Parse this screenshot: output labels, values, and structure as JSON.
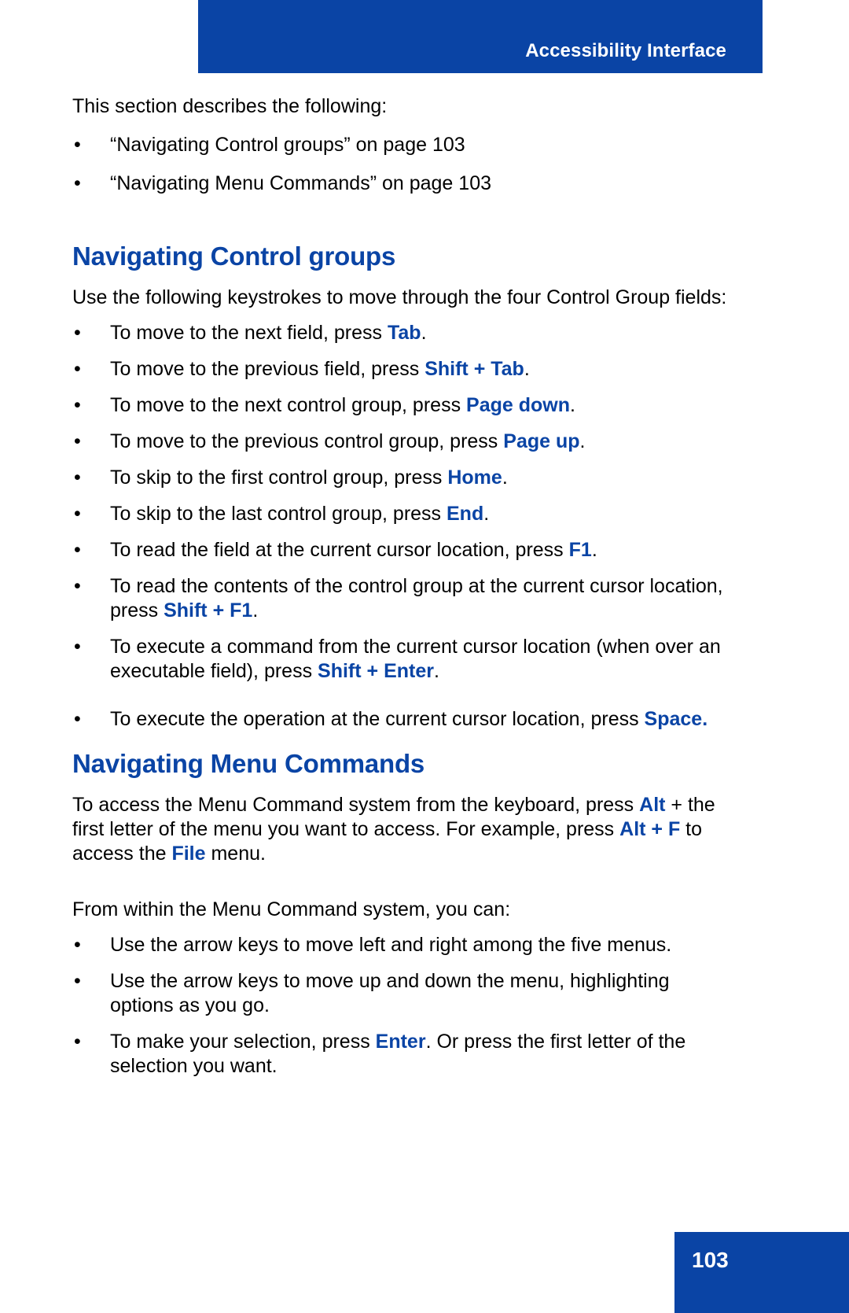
{
  "header": {
    "title": "Accessibility Interface",
    "accent_color": "#0A44A5"
  },
  "intro": {
    "lead": "This section describes the following:",
    "toc": [
      "“Navigating Control groups” on page 103",
      "“Navigating Menu Commands” on page 103"
    ]
  },
  "bullet_glyph": "•",
  "sections": [
    {
      "heading": "Navigating Control groups",
      "intro": "Use the following keystrokes to move through the four Control Group fields:",
      "items": [
        {
          "pre": "To move to the next field, press ",
          "key": "Tab",
          "post": "."
        },
        {
          "pre": "To move to the previous field, press ",
          "key": "Shift + Tab",
          "post": "."
        },
        {
          "pre": "To move to the next control group, press ",
          "key": "Page down",
          "post": "."
        },
        {
          "pre": "To move to the previous control group, press ",
          "key": "Page up",
          "post": "."
        },
        {
          "pre": "To skip to the first control group, press ",
          "key": "Home",
          "post": "."
        },
        {
          "pre": "To skip to the last control group, press ",
          "key": "End",
          "post": "."
        },
        {
          "pre": "To read the field at the current cursor location, press ",
          "key": "F1",
          "post": "."
        },
        {
          "pre": "To read the contents of the control group at the current cursor location, press ",
          "key": "Shift + F1",
          "post": "."
        },
        {
          "pre": "To execute a command from the current cursor location (when over an executable field), press ",
          "key": "Shift + Enter",
          "post": "."
        },
        {
          "pre": "To execute the operation at the current cursor location, press ",
          "key": "Space.",
          "post": ""
        }
      ]
    },
    {
      "heading": "Navigating Menu Commands",
      "para1_part1": "To access the Menu Command system from the keyboard, press ",
      "para1_key1": "Alt",
      "para1_part2": " + the first letter of the menu you want to access. For example, press ",
      "para1_key2": "Alt + F",
      "para1_part3": " to access the ",
      "para1_key3": "File",
      "para1_part4": " menu.",
      "para2": "From within the Menu Command system, you can:",
      "items": [
        {
          "pre": "Use the arrow keys to move left and right among the five menus.",
          "key": "",
          "post": ""
        },
        {
          "pre": "Use the arrow keys to move up and down the menu, highlighting options as you go.",
          "key": "",
          "post": ""
        },
        {
          "pre": "To make your selection, press ",
          "key": "Enter",
          "post": ". Or press the first letter of the selection you want."
        }
      ]
    }
  ],
  "footer": {
    "page_number": "103"
  }
}
